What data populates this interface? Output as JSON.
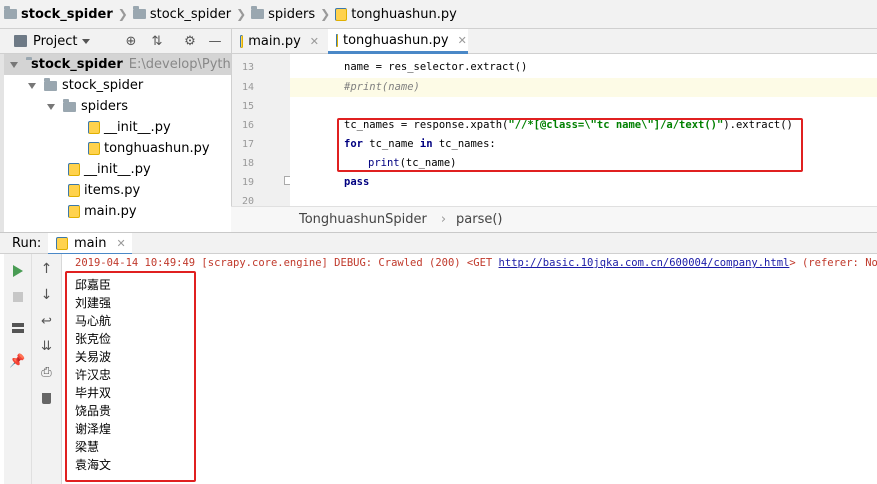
{
  "breadcrumb": {
    "items": [
      "stock_spider",
      "stock_spider",
      "spiders",
      "tonghuashun.py"
    ]
  },
  "project_panel": {
    "title": "Project",
    "tree": [
      {
        "label": "stock_spider",
        "suffix": "E:\\develop\\Python",
        "depth": 0,
        "type": "folder",
        "bold": true,
        "expanded": true
      },
      {
        "label": "stock_spider",
        "depth": 1,
        "type": "folder",
        "expanded": true
      },
      {
        "label": "spiders",
        "depth": 2,
        "type": "folder",
        "expanded": true
      },
      {
        "label": "__init__.py",
        "depth": 3,
        "type": "py"
      },
      {
        "label": "tonghuashun.py",
        "depth": 3,
        "type": "py"
      },
      {
        "label": "__init__.py",
        "depth": 2,
        "type": "py"
      },
      {
        "label": "items.py",
        "depth": 2,
        "type": "py"
      },
      {
        "label": "main.py",
        "depth": 2,
        "type": "py"
      }
    ]
  },
  "editor": {
    "tabs": [
      {
        "label": "main.py",
        "active": false
      },
      {
        "label": "tonghuashun.py",
        "active": true
      }
    ],
    "line_numbers": [
      "13",
      "14",
      "15",
      "16",
      "17",
      "18",
      "19",
      "20"
    ],
    "code": {
      "l13": "name = res_selector.extract()",
      "l14": "#print(name)",
      "l16_a": "tc_names = response.xpath(",
      "l16_str": "\"//*[@class=\\\"tc name\\\"]/a/text()\"",
      "l16_b": ").extract()",
      "l17_kw1": "for",
      "l17_a": " tc_name ",
      "l17_kw2": "in",
      "l17_b": " tc_names:",
      "l18_fn": "print",
      "l18_a": "(tc_name)",
      "l19_kw": "pass"
    },
    "crumb": {
      "class_name": "TonghuashunSpider",
      "method": "parse()"
    }
  },
  "run_panel": {
    "label": "Run:",
    "tab": "main",
    "debug_prefix": "2019-04-14 10:49:49 [scrapy.core.engine] DEBUG: Crawled (200) <GET ",
    "debug_url": "http://basic.10jqka.com.cn/600004/company.html",
    "debug_suffix": "> (referer: None)",
    "names": [
      "邱嘉臣",
      "刘建强",
      "马心航",
      "张克俭",
      "关易波",
      "许汉忠",
      "毕井双",
      "饶品贵",
      "谢泽煌",
      "梁慧",
      "袁海文"
    ]
  },
  "colors": {
    "highlight_box": "#e02020",
    "run_green": "#499c54",
    "tab_accent": "#4a88c7"
  },
  "icons": [
    "folder-icon",
    "python-file-icon",
    "target-icon",
    "collapse-icon",
    "gear-icon",
    "minimize-icon",
    "run-icon",
    "stop-icon",
    "up-arrow-icon",
    "down-arrow-icon",
    "wrap-icon",
    "scroll-end-icon",
    "layout-icon",
    "print-icon",
    "pin-icon",
    "trash-icon"
  ]
}
